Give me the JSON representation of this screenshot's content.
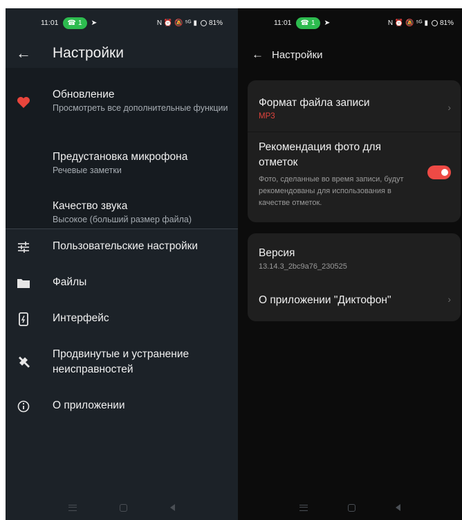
{
  "status": {
    "time": "11:01",
    "call_badge": "1",
    "indicators": "N ⏰ 🔕 ⁵ᴳ",
    "battery": "81%"
  },
  "left": {
    "title": "Настройки",
    "items": [
      {
        "title": "Обновление",
        "subtitle": "Просмотреть все дополнительные функции",
        "icon": "heart-icon"
      },
      {
        "title": "Предустановка микрофона",
        "subtitle": "Речевые заметки"
      },
      {
        "title": "Качество звука",
        "subtitle": "Высокое (больший размер файла)"
      }
    ],
    "menu": [
      {
        "title": "Пользовательские настройки",
        "icon": "sliders-icon"
      },
      {
        "title": "Файлы",
        "icon": "folder-icon"
      },
      {
        "title": "Интерфейс",
        "icon": "phone-icon"
      },
      {
        "title": "Продвинутые и устранение неисправностей",
        "icon": "wrench-icon"
      },
      {
        "title": "О приложении",
        "icon": "info-icon"
      }
    ]
  },
  "right": {
    "title": "Настройки",
    "format": {
      "title": "Формат файла записи",
      "value": "MP3"
    },
    "photo": {
      "title": "Рекомендация фото для отметок",
      "description": "Фото, сделанные во время записи, будут рекомендованы для использования в качестве отметок.",
      "enabled": true
    },
    "version": {
      "title": "Версия",
      "value": "13.14.3_2bc9a76_230525"
    },
    "about": {
      "title": "О приложении \"Диктофон\""
    }
  },
  "colors": {
    "accent": "#ee4a45",
    "heart": "#e8453c",
    "call_pill": "#2dbb4f"
  }
}
